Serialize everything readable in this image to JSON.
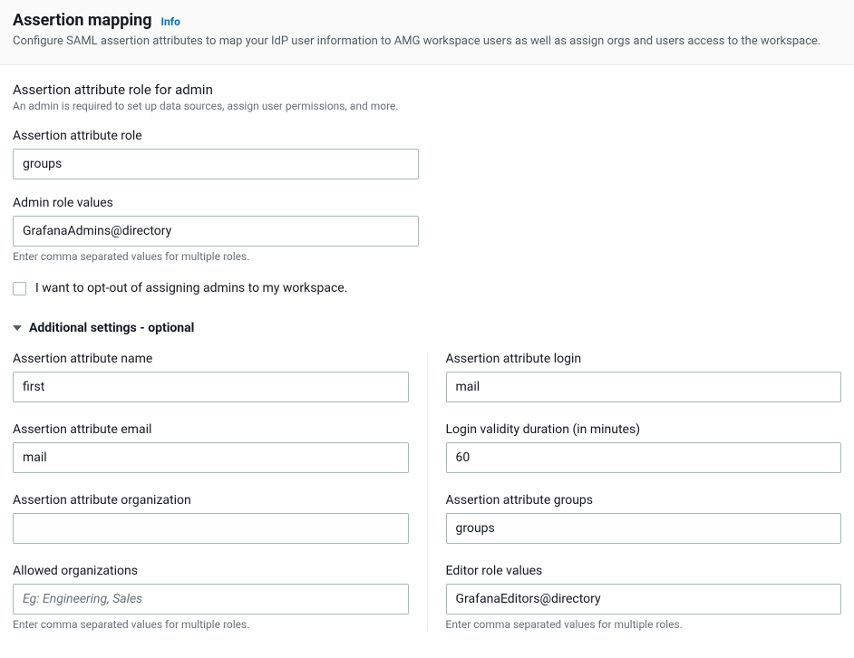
{
  "header": {
    "title": "Assertion mapping",
    "info_label": "Info",
    "description": "Configure SAML assertion attributes to map your IdP user information to AMG workspace users as well as assign orgs and users access to the workspace."
  },
  "admin_section": {
    "title": "Assertion attribute role for admin",
    "subtitle": "An admin is required to set up data sources, assign user permissions, and more.",
    "role_label": "Assertion attribute role",
    "role_value": "groups",
    "admin_values_label": "Admin role values",
    "admin_values_value": "GrafanaAdmins@directory",
    "admin_values_helper": "Enter comma separated values for multiple roles.",
    "optout_label": "I want to opt-out of assigning admins to my workspace."
  },
  "additional": {
    "title": "Additional settings - optional",
    "left": {
      "name_label": "Assertion attribute name",
      "name_value": "first",
      "email_label": "Assertion attribute email",
      "email_value": "mail",
      "org_label": "Assertion attribute organization",
      "org_value": "",
      "allowed_orgs_label": "Allowed organizations",
      "allowed_orgs_value": "",
      "allowed_orgs_placeholder": "Eg: Engineering, Sales",
      "allowed_orgs_helper": "Enter comma separated values for multiple roles."
    },
    "right": {
      "login_label": "Assertion attribute login",
      "login_value": "mail",
      "validity_label": "Login validity duration (in minutes)",
      "validity_value": "60",
      "groups_label": "Assertion attribute groups",
      "groups_value": "groups",
      "editor_label": "Editor role values",
      "editor_value": "GrafanaEditors@directory",
      "editor_helper": "Enter comma separated values for multiple roles."
    }
  }
}
